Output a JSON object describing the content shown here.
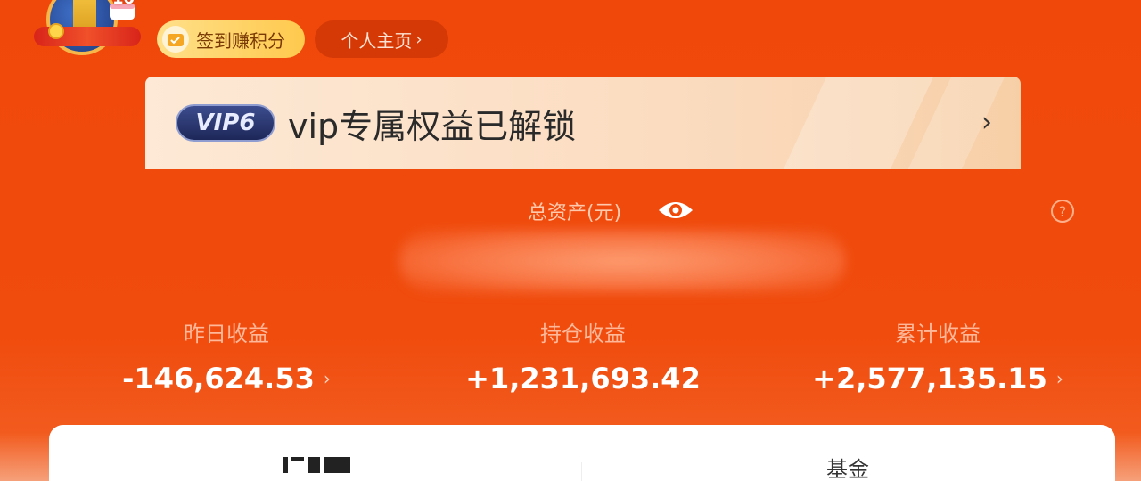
{
  "header": {
    "avatar_badge": "10",
    "signin_label": "签到赚积分",
    "profile_label": "个人主页"
  },
  "vip": {
    "badge": "VIP6",
    "text": "vip专属权益已解锁"
  },
  "assets": {
    "label": "总资产(元)",
    "value_hidden": true
  },
  "earnings": [
    {
      "label": "昨日收益",
      "value": "-146,624.53"
    },
    {
      "label": "持仓收益",
      "value": "+1,231,693.42"
    },
    {
      "label": "累计收益",
      "value": "+2,577,135.15"
    }
  ],
  "tabs": {
    "tab2": "基金"
  },
  "colors": {
    "background": "#f04a0a",
    "vip_banner": "#fbdcc0",
    "signin_pill": "#ffc94d"
  }
}
